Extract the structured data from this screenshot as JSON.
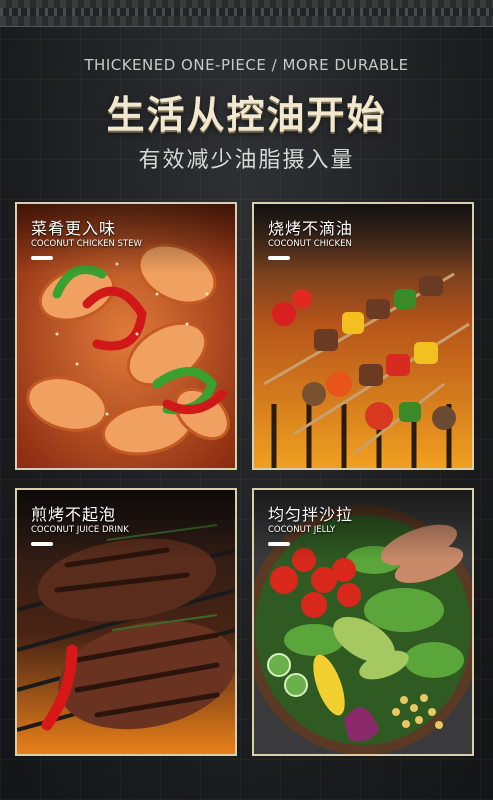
{
  "header": {
    "eng_title": "THICKENED ONE-PIECE / MORE DURABLE",
    "main_title": "生活从控油开始",
    "sub_title": "有效减少油脂摄入量"
  },
  "cards": [
    {
      "title": "菜肴更入味",
      "subtitle": "COCONUT CHICKEN STEW",
      "image": "shrimp-dish"
    },
    {
      "title": "烧烤不滴油",
      "subtitle": "COCONUT CHICKEN",
      "image": "bbq-skewers"
    },
    {
      "title": "煎烤不起泡",
      "subtitle": "COCONUT JUICE DRINK",
      "image": "grilled-steak"
    },
    {
      "title": "均匀拌沙拉",
      "subtitle": "COCONUT JELLY",
      "image": "salad-bowl"
    }
  ],
  "colors": {
    "background": "#1c1d1f",
    "card_border": "#d9cfae",
    "title_gold": "#f2e8cf"
  }
}
